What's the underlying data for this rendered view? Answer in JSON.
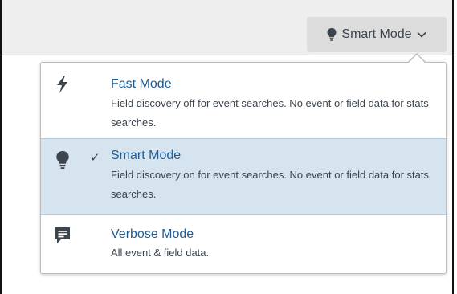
{
  "mode_button": {
    "label": "Smart Mode",
    "icon": "bulb-icon"
  },
  "menu": {
    "items": [
      {
        "title": "Fast Mode",
        "description": "Field discovery off for event searches. No event or field data for stats searches.",
        "icon": "lightning-icon",
        "selected": false
      },
      {
        "title": "Smart Mode",
        "description": "Field discovery on for event searches. No event or field data for stats searches.",
        "icon": "bulb-icon",
        "selected": true,
        "check": "✓"
      },
      {
        "title": "Verbose Mode",
        "description": "All event & field data.",
        "icon": "message-icon",
        "selected": false
      }
    ]
  },
  "colors": {
    "title": "#1d5d94",
    "text": "#3c444d",
    "selected_bg": "#d6e4f0"
  }
}
